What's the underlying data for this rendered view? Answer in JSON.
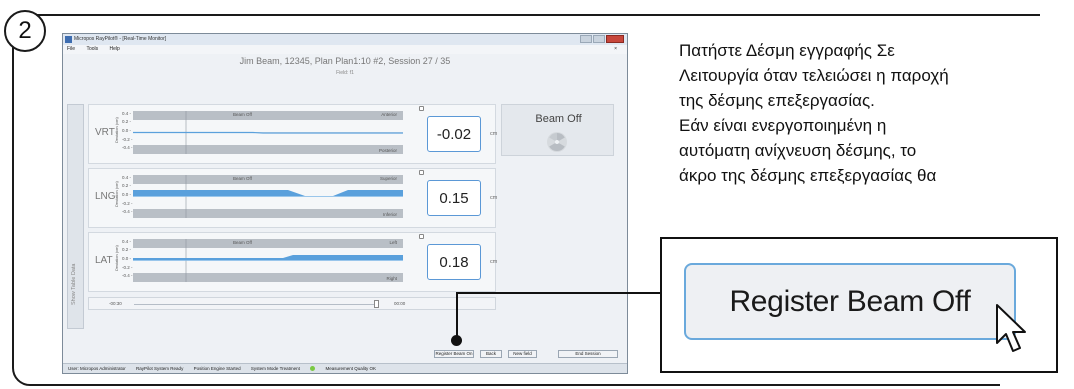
{
  "step": {
    "number": "2"
  },
  "app": {
    "window_title": "Micropos RayPilot® - [Real-Time Monitor]",
    "menu": [
      "File",
      "Tools",
      "Help"
    ],
    "menu_close": "×",
    "plan_title": "Jim Beam, 12345, Plan Plan1:10 #2, Session 27 / 35",
    "field": "Field: f1",
    "side_tab": "Show Table Data",
    "axis_ylabel": "Deviation (cm)",
    "ticks": [
      "0.4 -",
      "0.2 -",
      "0.0 -",
      "-0.2 -",
      "-0.4 -"
    ],
    "axes": [
      {
        "name": "VRT",
        "beam_label": "Beam Off",
        "top_label": "Anterior",
        "bottom_label": "Posterior",
        "value": "-0.02",
        "unit": "cm"
      },
      {
        "name": "LNG",
        "beam_label": "Beam Off",
        "top_label": "Superior",
        "bottom_label": "Inferior",
        "value": "0.15",
        "unit": "cm"
      },
      {
        "name": "LAT",
        "beam_label": "Beam Off",
        "top_label": "Left",
        "bottom_label": "Right",
        "value": "0.18",
        "unit": "cm"
      }
    ],
    "beam_status": "Beam Off",
    "timeline": {
      "start": "-00:30",
      "end": "00:00"
    },
    "buttons": {
      "register": "Register Beam On",
      "back": "Back",
      "new_field": "New field",
      "end_session": "End Session"
    },
    "status": {
      "user": "User: Micropos Administrator",
      "system": "RayPilot System Ready",
      "engine": "Position Engine Started",
      "mode": "System Mode Treatment",
      "quality": "Measurement Quality OK"
    }
  },
  "description": [
    "Πατήστε Δέσμη εγγραφής Σε",
    "Λειτουργία όταν τελειώσει η παροχή",
    "της δέσμης επεξεργασίας.",
    "Εάν είναι ενεργοποιημένη η",
    "αυτόματη ανίχνευση δέσμης, το",
    "άκρο της δέσμης επεξεργασίας θα"
  ],
  "zoom": {
    "button_label": "Register Beam Off"
  },
  "colors": {
    "accent": "#5b98d6",
    "fill": "#5aa0dc",
    "status_ok": "#7ac943"
  }
}
